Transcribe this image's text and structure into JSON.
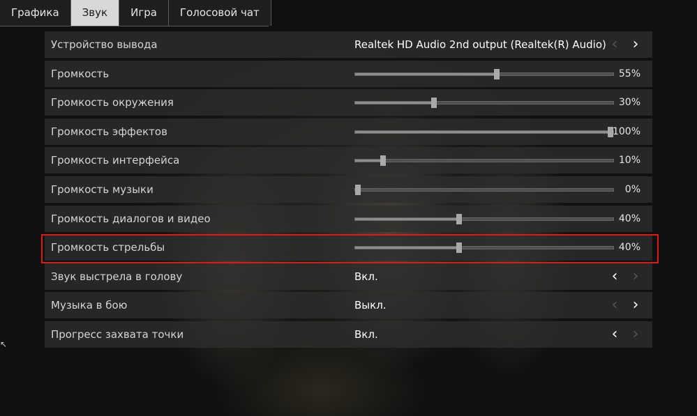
{
  "tabs": [
    {
      "label": "Графика",
      "active": false
    },
    {
      "label": "Звук",
      "active": true
    },
    {
      "label": "Игра",
      "active": false
    },
    {
      "label": "Голосовой чат",
      "active": false
    }
  ],
  "settings": {
    "output_device": {
      "label": "Устройство вывода",
      "value": "Realtek HD Audio 2nd output (Realtek(R) Audio)"
    },
    "volume": {
      "label": "Громкость",
      "percent": 55,
      "display": "55%"
    },
    "ambient": {
      "label": "Громкость окружения",
      "percent": 30,
      "display": "30%"
    },
    "effects": {
      "label": "Громкость эффектов",
      "percent": 100,
      "display": "100%"
    },
    "interface": {
      "label": "Громкость интерфейса",
      "percent": 10,
      "display": "10%"
    },
    "music": {
      "label": "Громкость музыки",
      "percent": 0,
      "display": "0%"
    },
    "dialogs": {
      "label": "Громкость диалогов и видео",
      "percent": 40,
      "display": "40%"
    },
    "gunfire": {
      "label": "Громкость стрельбы",
      "percent": 40,
      "display": "40%"
    },
    "headshot": {
      "label": "Звук выстрела в голову",
      "value": "Вкл."
    },
    "combat_music": {
      "label": "Музыка в бою",
      "value": "Выкл."
    },
    "capture_progress": {
      "label": "Прогресс захвата точки",
      "value": "Вкл."
    }
  },
  "icons": {
    "arrow_left": "‹",
    "arrow_right": "›"
  },
  "colors": {
    "highlight": "#e01818",
    "tab_active_bg": "#d8d8d8"
  }
}
